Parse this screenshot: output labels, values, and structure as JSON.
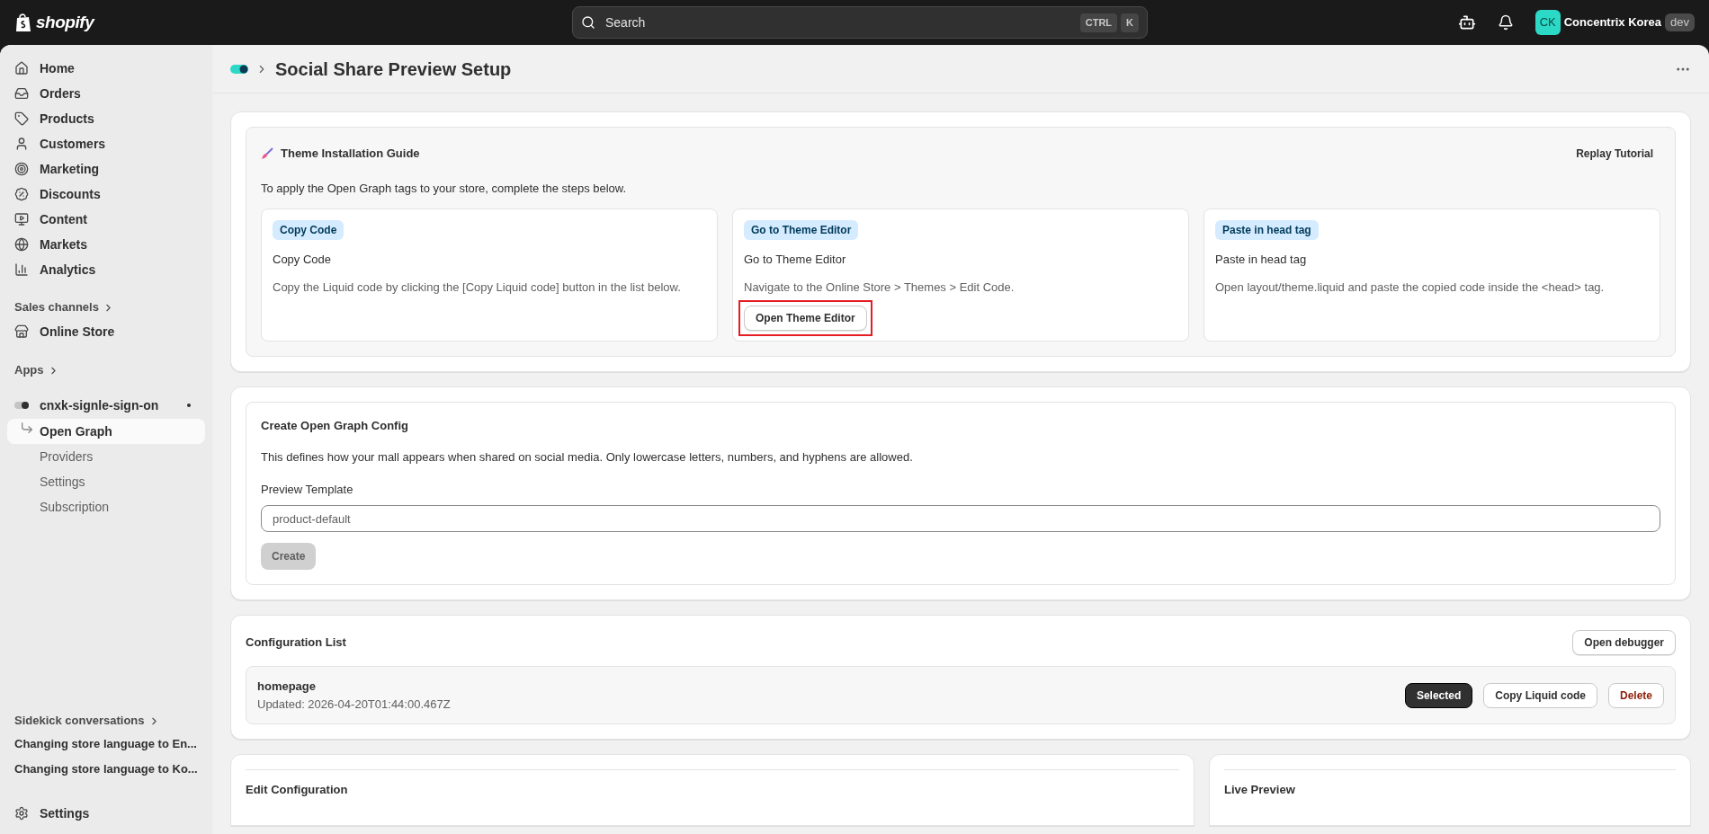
{
  "topbar": {
    "brand": "shopify",
    "search": {
      "placeholder": "Search",
      "keys": [
        "CTRL",
        "K"
      ]
    },
    "store": {
      "initials": "CK",
      "name": "Concentrix Korea",
      "badge": "dev"
    }
  },
  "sidebar": {
    "nav": [
      {
        "label": "Home"
      },
      {
        "label": "Orders"
      },
      {
        "label": "Products"
      },
      {
        "label": "Customers"
      },
      {
        "label": "Marketing"
      },
      {
        "label": "Discounts"
      },
      {
        "label": "Content"
      },
      {
        "label": "Markets"
      },
      {
        "label": "Analytics"
      }
    ],
    "sales_channels": {
      "label": "Sales channels",
      "items": [
        {
          "label": "Online Store"
        }
      ]
    },
    "apps": {
      "label": "Apps",
      "app": {
        "name": "cnxk-signle-sign-on",
        "items": [
          {
            "label": "Open Graph",
            "selected": true
          },
          {
            "label": "Providers",
            "selected": false
          },
          {
            "label": "Settings",
            "selected": false
          },
          {
            "label": "Subscription",
            "selected": false
          }
        ]
      }
    },
    "sidekick": {
      "label": "Sidekick conversations",
      "items": [
        "Changing store language to En...",
        "Changing store language to Ko..."
      ]
    },
    "settings": "Settings"
  },
  "page": {
    "title": "Social Share Preview Setup"
  },
  "guide": {
    "title": "Theme Installation Guide",
    "action": "Replay Tutorial",
    "intro": "To apply the Open Graph tags to your store, complete the steps below.",
    "steps": [
      {
        "badge": "Copy Code",
        "title": "Copy Code",
        "description": "Copy the Liquid code by clicking the [Copy Liquid code] button in the list below."
      },
      {
        "badge": "Go to Theme Editor",
        "title": "Go to Theme Editor",
        "description": "Navigate to the Online Store > Themes > Edit Code.",
        "button": "Open Theme Editor"
      },
      {
        "badge": "Paste in head tag",
        "title": "Paste in head tag",
        "description": "Open layout/theme.liquid and paste the copied code inside the <head> tag."
      }
    ]
  },
  "create": {
    "title": "Create Open Graph Config",
    "description": "This defines how your mall appears when shared on social media. Only lowercase letters, numbers, and hyphens are allowed.",
    "field_label": "Preview Template",
    "placeholder": "product-default",
    "button": {
      "label": "Create",
      "disabled": true
    }
  },
  "config_list": {
    "title": "Configuration List",
    "action": "Open debugger",
    "items": [
      {
        "name": "homepage",
        "updated": "Updated: 2026-04-20T01:44:00.467Z",
        "select_label": "Selected",
        "selected": true,
        "copy": "Copy Liquid code",
        "delete": "Delete"
      }
    ]
  },
  "bottom": {
    "edit_title": "Edit Configuration",
    "preview_title": "Live Preview"
  }
}
